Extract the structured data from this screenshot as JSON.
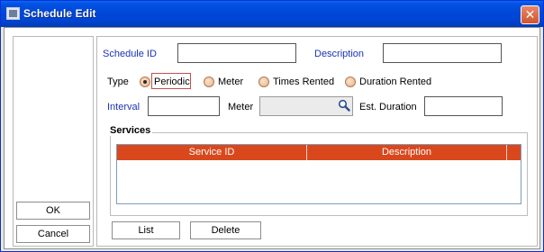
{
  "window": {
    "title": "Schedule Edit",
    "close_glyph": "✕"
  },
  "actions": {
    "ok": "OK",
    "cancel": "Cancel"
  },
  "form": {
    "schedule_id_label": "Schedule ID",
    "schedule_id_value": "",
    "description_label": "Description",
    "description_value": "",
    "type_label": "Type",
    "type_options": [
      "Periodic",
      "Meter",
      "Times Rented",
      "Duration Rented"
    ],
    "type_selected": "Periodic",
    "interval_label": "Interval",
    "interval_value": "",
    "meter_label": "Meter",
    "meter_value": "",
    "est_duration_label": "Est. Duration",
    "est_duration_value": ""
  },
  "services": {
    "legend": "Services",
    "columns": [
      "Service ID",
      "Description"
    ],
    "rows": [],
    "list_button": "List",
    "delete_button": "Delete"
  },
  "colors": {
    "accent_label": "#1c33b5",
    "table_header": "#d9481d"
  }
}
